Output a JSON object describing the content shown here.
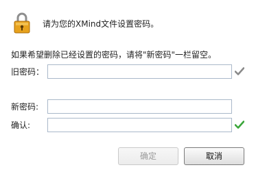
{
  "header": {
    "icon": "padlock-icon",
    "message": "请为您的XMind文件设置密码。"
  },
  "instruction": "如果希望删除已经设置的密码，请将\"新密码\"一栏留空。",
  "fields": {
    "old_password": {
      "label": "旧密码：",
      "value": "",
      "status_icon": "check-icon",
      "status_color": "#8a8a8a"
    },
    "new_password": {
      "label": "新密码:",
      "value": ""
    },
    "confirm": {
      "label": "确认:",
      "value": "",
      "status_icon": "check-icon",
      "status_color": "#3aa63a"
    }
  },
  "buttons": {
    "ok_label": "确定",
    "ok_enabled": false,
    "cancel_label": "取消"
  }
}
